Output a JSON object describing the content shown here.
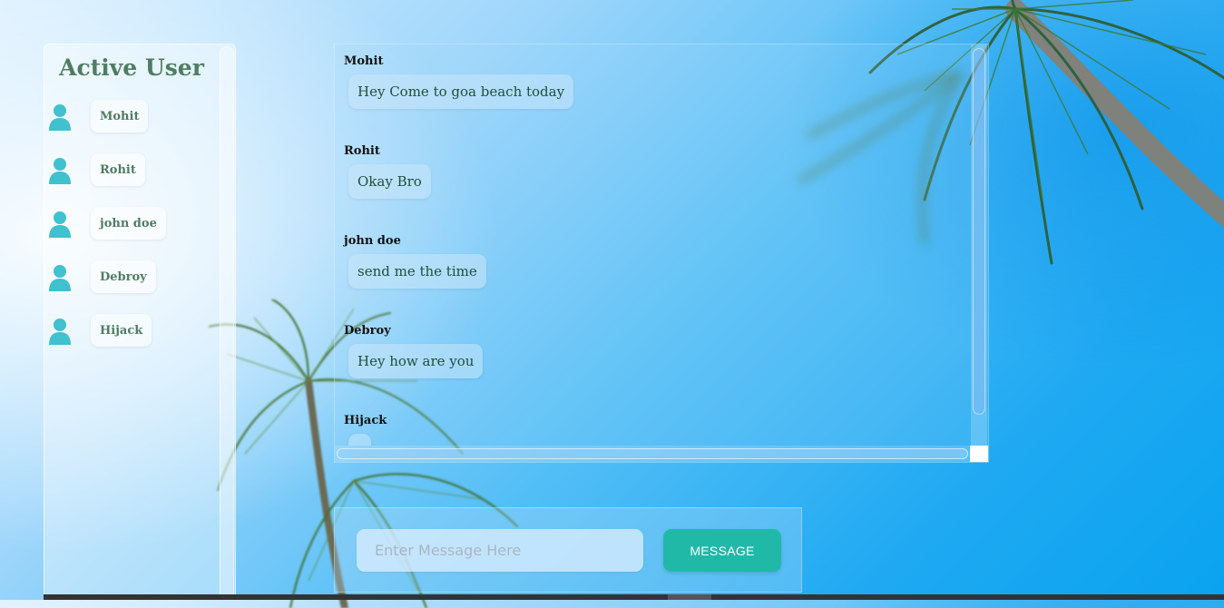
{
  "sidebar": {
    "title": "Active User",
    "users": [
      {
        "name": "Mohit"
      },
      {
        "name": "Rohit"
      },
      {
        "name": "john doe"
      },
      {
        "name": "Debroy"
      },
      {
        "name": "Hijack"
      }
    ]
  },
  "chat": {
    "messages": [
      {
        "sender": "Mohit",
        "text": "Hey Come to goa beach today"
      },
      {
        "sender": "Rohit",
        "text": "Okay Bro"
      },
      {
        "sender": "john doe",
        "text": "send me the time"
      },
      {
        "sender": "Debroy",
        "text": "Hey how are you"
      },
      {
        "sender": "Hijack",
        "text": "."
      }
    ]
  },
  "composer": {
    "placeholder": "Enter Message Here",
    "value": "",
    "send_label": "MESSAGE"
  },
  "icons": {
    "user": "user-icon"
  },
  "colors": {
    "accent": "#20b9a8",
    "user_icon": "#3fc1cf",
    "label_text": "#4f7d62"
  }
}
